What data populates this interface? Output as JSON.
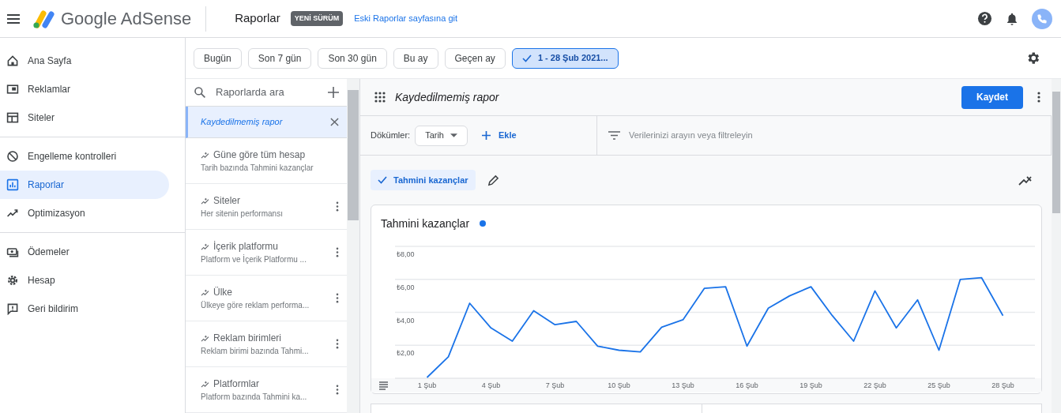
{
  "header": {
    "logo_text": "Google AdSense",
    "page_title": "Raporlar",
    "badge": "YENİ SÜRÜM",
    "link": "Eski Raporlar sayfasına git"
  },
  "date_ranges": [
    {
      "label": "Bugün",
      "selected": false
    },
    {
      "label": "Son 7 gün",
      "selected": false
    },
    {
      "label": "Son 30 gün",
      "selected": false
    },
    {
      "label": "Bu ay",
      "selected": false
    },
    {
      "label": "Geçen ay",
      "selected": false
    },
    {
      "label": "1 - 28 Şub 2021...",
      "selected": true
    }
  ],
  "nav": {
    "groups": [
      [
        {
          "label": "Ana Sayfa",
          "selected": false
        },
        {
          "label": "Reklamlar",
          "selected": false
        },
        {
          "label": "Siteler",
          "selected": false
        }
      ],
      [
        {
          "label": "Engelleme kontrolleri",
          "selected": false
        },
        {
          "label": "Raporlar",
          "selected": true
        },
        {
          "label": "Optimizasyon",
          "selected": false
        }
      ],
      [
        {
          "label": "Ödemeler",
          "selected": false
        },
        {
          "label": "Hesap",
          "selected": false
        },
        {
          "label": "Geri bildirim",
          "selected": false
        }
      ]
    ]
  },
  "reports": {
    "search_placeholder": "Raporlarda ara",
    "items": [
      {
        "title": "Kaydedilmemiş rapor",
        "selected": true
      },
      {
        "title": "Güne göre tüm hesap",
        "subtitle": "Tarih bazında Tahmini kazançlar",
        "selected": false
      },
      {
        "title": "Siteler",
        "subtitle": "Her sitenin performansı",
        "selected": false
      },
      {
        "title": "İçerik platformu",
        "subtitle": "Platform ve İçerik Platformu ...",
        "selected": false
      },
      {
        "title": "Ülke",
        "subtitle": "Ülkeye göre reklam performa...",
        "selected": false
      },
      {
        "title": "Reklam birimleri",
        "subtitle": "Reklam birimi bazında Tahmi...",
        "selected": false
      },
      {
        "title": "Platformlar",
        "subtitle": "Platform bazında Tahmini ka...",
        "selected": false
      }
    ]
  },
  "report": {
    "title": "Kaydedilmemiş rapor",
    "save_button": "Kaydet",
    "breakdowns_label": "Dökümler:",
    "breakdown": "Tarih",
    "add": "Ekle",
    "filter_placeholder": "Verilerinizi arayın veya filtreleyin",
    "metrics": [
      {
        "label": "Tahmini kazançlar",
        "selected": true
      }
    ],
    "chart": {
      "title": "Tahmini kazançlar",
      "color": "#1a73e8",
      "chart_data": {
        "type": "line",
        "grid": true,
        "x": [
          1,
          2,
          3,
          4,
          5,
          6,
          7,
          8,
          9,
          10,
          11,
          12,
          13,
          14,
          15,
          16,
          17,
          18,
          19,
          20,
          21,
          22,
          23,
          24,
          25,
          26,
          27,
          28
        ],
        "xlim": [
          -0.5,
          29.5
        ],
        "series": [
          {
            "color": "#1a73e8",
            "values": [
              0.05,
              1.3,
              4.55,
              3.05,
              2.25,
              4.1,
              3.25,
              3.45,
              1.95,
              1.7,
              1.6,
              3.1,
              3.55,
              5.45,
              5.55,
              1.95,
              4.25,
              5.0,
              5.55,
              3.8,
              2.25,
              5.3,
              3.05,
              4.75,
              1.7,
              6.0,
              6.1,
              3.8
            ]
          }
        ],
        "ylim": [
          0,
          8
        ],
        "yticks": [
          {
            "value": 2,
            "label": "₺2,00"
          },
          {
            "value": 4,
            "label": "₺4,00"
          },
          {
            "value": 6,
            "label": "₺6,00"
          },
          {
            "value": 8,
            "label": "₺8,00"
          }
        ],
        "xticks": [
          {
            "value": 1,
            "label": "1 Şub"
          },
          {
            "value": 4,
            "label": "4 Şub"
          },
          {
            "value": 7,
            "label": "7 Şub"
          },
          {
            "value": 10,
            "label": "10 Şub"
          },
          {
            "value": 13,
            "label": "13 Şub"
          },
          {
            "value": 16,
            "label": "16 Şub"
          },
          {
            "value": 19,
            "label": "19 Şub"
          },
          {
            "value": 22,
            "label": "22 Şub"
          },
          {
            "value": 25,
            "label": "25 Şub"
          },
          {
            "value": 28,
            "label": "28 Şub"
          }
        ]
      }
    }
  }
}
